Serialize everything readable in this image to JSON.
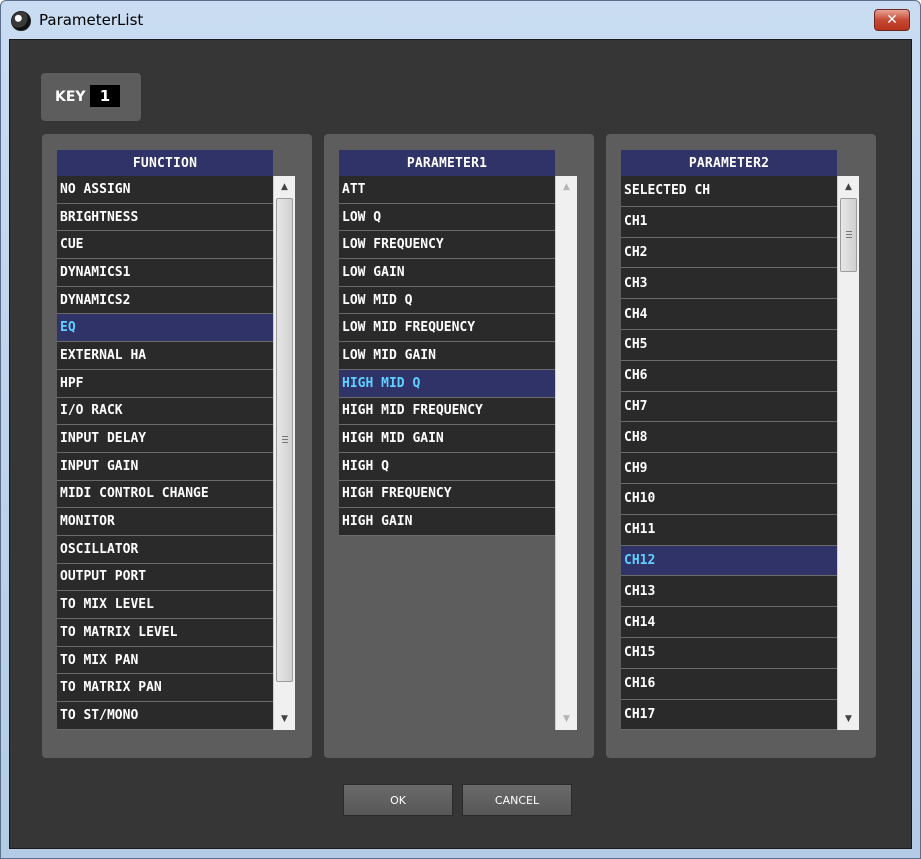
{
  "window": {
    "title": "ParameterList",
    "close_label": "✕"
  },
  "key": {
    "label": "KEY",
    "value": "1"
  },
  "function_list": {
    "header": "FUNCTION",
    "items": [
      "NO ASSIGN",
      "BRIGHTNESS",
      "CUE",
      "DYNAMICS1",
      "DYNAMICS2",
      "EQ",
      "EXTERNAL HA",
      "HPF",
      "I/O RACK",
      "INPUT DELAY",
      "INPUT GAIN",
      "MIDI CONTROL CHANGE",
      "MONITOR",
      "OSCILLATOR",
      "OUTPUT PORT",
      "TO MIX LEVEL",
      "TO MATRIX LEVEL",
      "TO MIX PAN",
      "TO MATRIX PAN",
      "TO ST/MONO"
    ],
    "selected": "EQ"
  },
  "parameter1_list": {
    "header": "PARAMETER1",
    "items": [
      "ATT",
      "LOW Q",
      "LOW FREQUENCY",
      "LOW GAIN",
      "LOW MID Q",
      "LOW MID FREQUENCY",
      "LOW MID GAIN",
      "HIGH MID Q",
      "HIGH MID FREQUENCY",
      "HIGH MID GAIN",
      "HIGH Q",
      "HIGH FREQUENCY",
      "HIGH GAIN"
    ],
    "selected": "HIGH MID Q"
  },
  "parameter2_list": {
    "header": "PARAMETER2",
    "items": [
      "SELECTED CH",
      "CH1",
      "CH2",
      "CH3",
      "CH4",
      "CH5",
      "CH6",
      "CH7",
      "CH8",
      "CH9",
      "CH10",
      "CH11",
      "CH12",
      "CH13",
      "CH14",
      "CH15",
      "CH16",
      "CH17"
    ],
    "selected": "CH12"
  },
  "buttons": {
    "ok": "OK",
    "cancel": "CANCEL"
  },
  "colors": {
    "background": "#363636",
    "panel": "#5d5d5d",
    "header": "#2f3368",
    "selected_text": "#5fd0ff",
    "list_bg": "#2a2a2a"
  }
}
